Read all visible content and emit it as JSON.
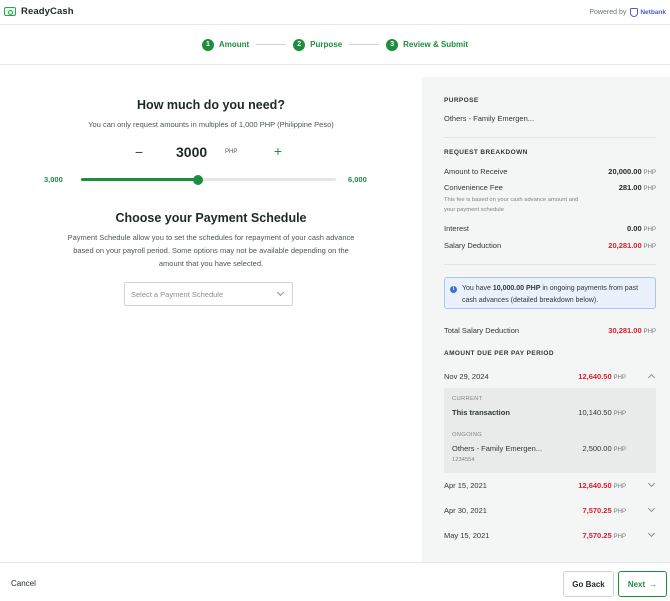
{
  "header": {
    "app_name": "ReadyCash",
    "powered_by": "Powered by",
    "partner": "Netbank"
  },
  "stepper": [
    {
      "num": "1",
      "label": "Amount"
    },
    {
      "num": "2",
      "label": "Purpose"
    },
    {
      "num": "3",
      "label": "Review & Submit"
    }
  ],
  "amount_section": {
    "title": "How much do you need?",
    "subtitle": "You can only request amounts in multiples of 1,000 PHP (Philippine Peso)",
    "minus": "−",
    "plus": "+",
    "value": "3000",
    "currency": "PHP",
    "slider_min_label": "3,000",
    "slider_max_label": "6,000",
    "slider_fill_fraction": 0.46
  },
  "schedule_section": {
    "title": "Choose your Payment Schedule",
    "description": "Payment Schedule allow you to set the schedules for repayment of your cash advance based on your payroll period. Some options may not be available depending on the amount that you have selected.",
    "placeholder": "Select a Payment Schedule"
  },
  "summary": {
    "purpose_title": "PURPOSE",
    "purpose_value": "Others - Family Emergen...",
    "breakdown_title": "REQUEST BREAKDOWN",
    "amount_to_receive_label": "Amount to Receive",
    "amount_to_receive_value": "20,000.00",
    "convenience_fee_label": "Convenience Fee",
    "convenience_fee_value": "281.00",
    "convenience_fee_note": "This fee is based on your cash advance amount and your payment schedule",
    "interest_label": "Interest",
    "interest_value": "0.00",
    "salary_deduction_label": "Salary Deduction",
    "salary_deduction_value": "20,281.00",
    "currency": "PHP",
    "info_prefix": "You have ",
    "info_amount": "10,000.00 PHP",
    "info_suffix": " in ongoing payments from past cash advances (detailed breakdown below).",
    "total_label": "Total Salary Deduction",
    "total_value": "30,281.00",
    "due_title": "AMOUNT DUE PER PAY PERIOD",
    "periods": [
      {
        "date": "Nov 29, 2024",
        "amount": "12,640.50"
      },
      {
        "date": "Apr 15, 2021",
        "amount": "12,640.50"
      },
      {
        "date": "Apr 30, 2021",
        "amount": "7,570.25"
      },
      {
        "date": "May 15, 2021",
        "amount": "7,570.25"
      }
    ],
    "expanded": {
      "current_label": "CURRENT",
      "current_name": "This transaction",
      "current_amount": "10,140.50",
      "ongoing_label": "ONGOING",
      "ongoing_name": "Others - Family Emergen...",
      "ongoing_amount": "2,500.00",
      "ongoing_id": "1234554"
    }
  },
  "footer": {
    "cancel": "Cancel",
    "back": "Go Back",
    "next": "Next",
    "next_arrow": "→"
  },
  "colors": {
    "primary_green": "#1e8e3e",
    "deduction_red": "#d6212f",
    "info_blue": "#3b6fd0"
  }
}
